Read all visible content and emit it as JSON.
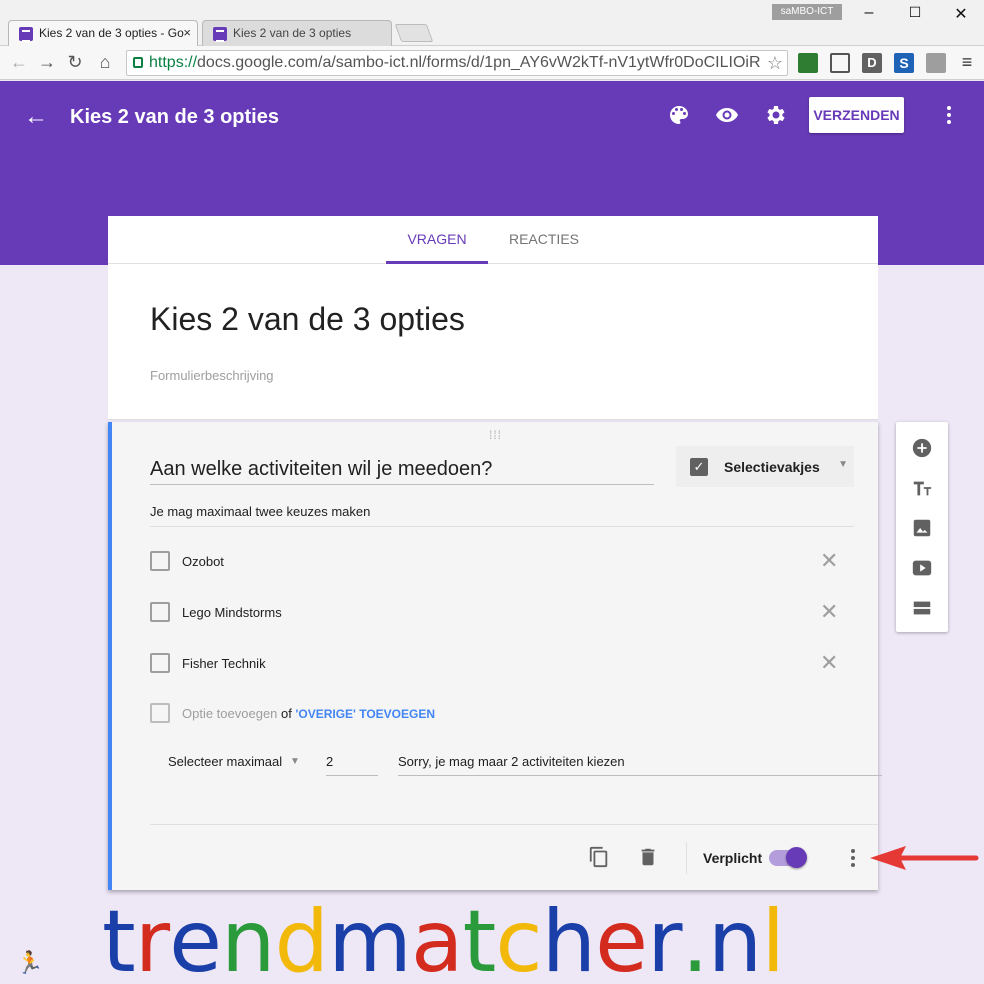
{
  "browser": {
    "tabs": [
      {
        "title": "Kies 2 van de 3 opties - Go",
        "close": "×"
      },
      {
        "title": "Kies 2 van de 3 opties"
      }
    ],
    "profile": "saMBO-ICT",
    "window_controls": [
      "–",
      "☐",
      "✕"
    ],
    "url_scheme": "https://",
    "url_rest": "docs.google.com/a/sambo-ict.nl/forms/d/1pn_AY6vW2kTf-nV1ytWfr0DoCILIOiR"
  },
  "header": {
    "title": "Kies 2 van de 3 opties",
    "send_label": "VERZENDEN",
    "color": "#673ab7"
  },
  "form_tabs": {
    "questions": "VRAGEN",
    "responses": "REACTIES"
  },
  "form": {
    "title": "Kies 2 van de 3 opties",
    "description_placeholder": "Formulierbeschrijving"
  },
  "question": {
    "title": "Aan welke activiteiten wil je meedoen?",
    "type": "Selectievakjes",
    "description": "Je mag maximaal twee keuzes maken",
    "options": [
      "Ozobot",
      "Lego Mindstorms",
      "Fisher Technik"
    ],
    "add_option": "Optie toevoegen",
    "or": "of",
    "add_other": "'OVERIGE' TOEVOEGEN",
    "validation": {
      "rule": "Selecteer maximaal",
      "number": "2",
      "error_text": "Sorry, je mag maar 2 activiteiten kiezen"
    },
    "required_label": "Verplicht",
    "required": true
  },
  "watermark": {
    "letters": [
      {
        "ch": "t",
        "color": "#1a3fa8"
      },
      {
        "ch": "r",
        "color": "#d42b1f"
      },
      {
        "ch": "e",
        "color": "#1a3fa8"
      },
      {
        "ch": "n",
        "color": "#2a9a3a"
      },
      {
        "ch": "d",
        "color": "#f2b90a"
      },
      {
        "ch": "m",
        "color": "#1a3fa8"
      },
      {
        "ch": "a",
        "color": "#d42b1f"
      },
      {
        "ch": "t",
        "color": "#2a9a3a"
      },
      {
        "ch": "c",
        "color": "#f2b90a"
      },
      {
        "ch": "h",
        "color": "#1a3fa8"
      },
      {
        "ch": "e",
        "color": "#d42b1f"
      },
      {
        "ch": "r",
        "color": "#1a3fa8"
      },
      {
        "ch": ".",
        "color": "#2a9a3a"
      },
      {
        "ch": "n",
        "color": "#1a3fa8"
      },
      {
        "ch": "l",
        "color": "#f2b90a"
      }
    ]
  }
}
